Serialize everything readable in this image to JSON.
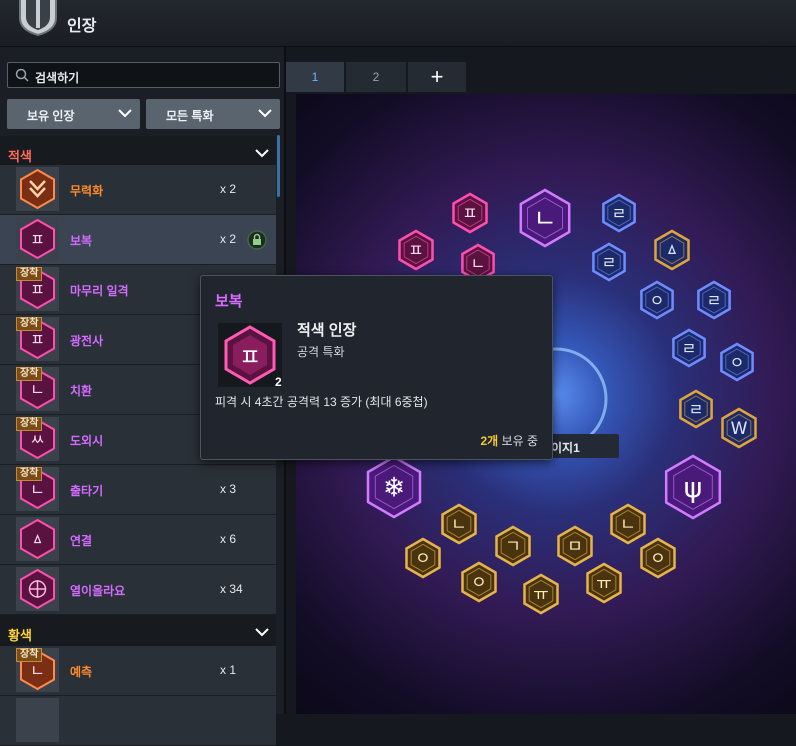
{
  "header": {
    "title": "인장"
  },
  "search": {
    "placeholder": "검색하기"
  },
  "filters": {
    "owned": "보유 인장",
    "spec": "모든 특화"
  },
  "equipped_tag": "장착",
  "sections": [
    {
      "name": "적색",
      "color": "#ff6b5a"
    },
    {
      "name": "황색",
      "color": "#ffd23b"
    }
  ],
  "red_items": [
    {
      "name": "무력화",
      "count": "x 2",
      "color": "#ff8a2a",
      "equipped": false,
      "glyph": "chevron"
    },
    {
      "name": "보복",
      "count": "x 2",
      "color": "#d36bff",
      "equipped": false,
      "glyph": "ㅍ"
    },
    {
      "name": "마무리 일격",
      "count": "",
      "color": "#d36bff",
      "equipped": true,
      "glyph": "ㅍ"
    },
    {
      "name": "광전사",
      "count": "",
      "color": "#d36bff",
      "equipped": true,
      "glyph": "ㅍ"
    },
    {
      "name": "치환",
      "count": "",
      "color": "#d36bff",
      "equipped": true,
      "glyph": "ㄴ"
    },
    {
      "name": "도외시",
      "count": "",
      "color": "#d36bff",
      "equipped": true,
      "glyph": "ㅆ"
    },
    {
      "name": "출타기",
      "count": "x 3",
      "color": "#d36bff",
      "equipped": true,
      "glyph": "ㄴ"
    },
    {
      "name": "연결",
      "count": "x 6",
      "color": "#d36bff",
      "equipped": false,
      "glyph": "ㅿ"
    },
    {
      "name": "열이올라요",
      "count": "x 34",
      "color": "#d36bff",
      "equipped": false,
      "glyph": "target"
    }
  ],
  "yellow_items": [
    {
      "name": "예측",
      "count": "x 1",
      "color": "#ff8a2a",
      "equipped": true,
      "glyph": "ㄴ"
    }
  ],
  "tabs": [
    "1",
    "2",
    "+"
  ],
  "tooltip": {
    "title": "보복",
    "category": "적색 인장",
    "spec": "공격 특화",
    "quantity": "2",
    "description": "피격 시 4초간 공격력 13 증가 (최대 6중첩)",
    "owned_count": "2개",
    "owned_suffix": " 보유 중"
  },
  "page_label": "이지1",
  "board": {
    "sigils": [
      {
        "glyph": "ㅍ",
        "kind": "red"
      },
      {
        "glyph": "ㄴ",
        "kind": "purple"
      },
      {
        "glyph": "ㄹ",
        "kind": "blue"
      },
      {
        "glyph": "ㅍ",
        "kind": "red"
      },
      {
        "glyph": "ㄴ",
        "kind": "red"
      },
      {
        "glyph": "ㄹ",
        "kind": "blue"
      },
      {
        "glyph": "ㅿ",
        "kind": "gold-blue"
      },
      {
        "glyph": "ㅇ",
        "kind": "blue"
      },
      {
        "glyph": "ㄹ",
        "kind": "blue"
      },
      {
        "glyph": "ㄹ",
        "kind": "blue"
      },
      {
        "glyph": "ㅇ",
        "kind": "blue"
      },
      {
        "glyph": "ㄹ",
        "kind": "gold-blue"
      },
      {
        "glyph": "W",
        "kind": "gold-blue"
      },
      {
        "glyph": "❄",
        "kind": "purple"
      },
      {
        "glyph": "ψ",
        "kind": "purple"
      },
      {
        "glyph": "ㄴ",
        "kind": "gold"
      },
      {
        "glyph": "ㄱ",
        "kind": "gold"
      },
      {
        "glyph": "ㅁ",
        "kind": "gold"
      },
      {
        "glyph": "ㄴ",
        "kind": "gold"
      },
      {
        "glyph": "ㅇ",
        "kind": "gold"
      },
      {
        "glyph": "ㅇ",
        "kind": "gold"
      },
      {
        "glyph": "ㅇ",
        "kind": "gold"
      },
      {
        "glyph": "ㅠ",
        "kind": "gold"
      },
      {
        "glyph": "ㅠ",
        "kind": "gold"
      }
    ]
  },
  "colors": {
    "red_section": "#ff6b5a",
    "yellow_section": "#ffd23b",
    "tab_active": "#6fb1ff",
    "tooltip_title": "#d56bff",
    "owned_highlight": "#f3c83b"
  }
}
